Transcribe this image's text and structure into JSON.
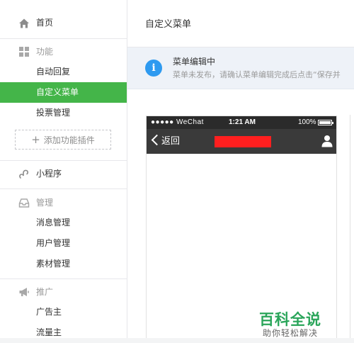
{
  "sidebar": {
    "home": "首页",
    "features": {
      "heading": "功能",
      "items": [
        "自动回复",
        "自定义菜单",
        "投票管理"
      ],
      "active_index": 1,
      "add_plugin": "添加功能插件"
    },
    "mini_program": "小程序",
    "manage": {
      "heading": "管理",
      "items": [
        "消息管理",
        "用户管理",
        "素材管理"
      ]
    },
    "promote": {
      "heading": "推广",
      "items": [
        "广告主",
        "流量主"
      ]
    }
  },
  "main": {
    "page_title": "自定义菜单",
    "notice": {
      "title": "菜单编辑中",
      "description": "菜单未发布，请确认菜单编辑完成后点击“保存并"
    }
  },
  "phone": {
    "carrier": "●●●●● WeChat",
    "time": "1:21 AM",
    "battery": "100%",
    "back_label": "返回"
  },
  "watermark": {
    "brand": "百科全说",
    "tagline": "助你轻松解决"
  },
  "colors": {
    "accent_green": "#44b549",
    "info_blue": "#2e9af0",
    "redaction": "#ff1f1f",
    "watermark_green": "#2aa55a"
  }
}
